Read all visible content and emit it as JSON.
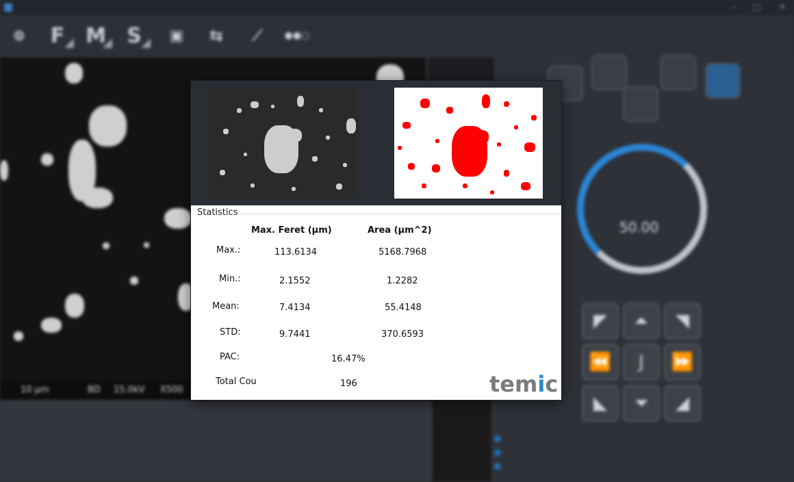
{
  "statistics": {
    "title": "Statistics",
    "columns": [
      "Max. Feret (µm)",
      "Area (µm^2)"
    ],
    "rows": [
      {
        "label": "Max.:",
        "feret": "113.6134",
        "area": "5168.7968"
      },
      {
        "label": "Min.:",
        "feret": "2.1552",
        "area": "1.2282"
      },
      {
        "label": "Mean:",
        "feret": "7.4134",
        "area": "55.4148"
      },
      {
        "label": "STD:",
        "feret": "9.7441",
        "area": "370.6593"
      }
    ],
    "pac": {
      "label": "PAC:",
      "value": "16.47%"
    },
    "total": {
      "label": "Total Cou",
      "value": "196"
    }
  },
  "logo": {
    "left": "tem",
    "accent": "i",
    "right": "c"
  },
  "background": {
    "toolbar": [
      {
        "letter": "F"
      },
      {
        "letter": "M"
      },
      {
        "letter": "S"
      }
    ],
    "dial_value": "50.00",
    "scalebar": [
      "10 µm",
      "BD",
      "15.0kV",
      "X500"
    ]
  },
  "colors": {
    "segmentation": "#ff0000",
    "accent": "#2f87c9",
    "dialog_top": "#2a2d33",
    "app_bg": "#2b2e34"
  },
  "icons": [
    "app-icon",
    "stage-icon",
    "camera-icon",
    "transfer-icon",
    "ruler-icon",
    "record-icon",
    "contrast-icon",
    "focus-icon",
    "arrow-pad-icons"
  ]
}
